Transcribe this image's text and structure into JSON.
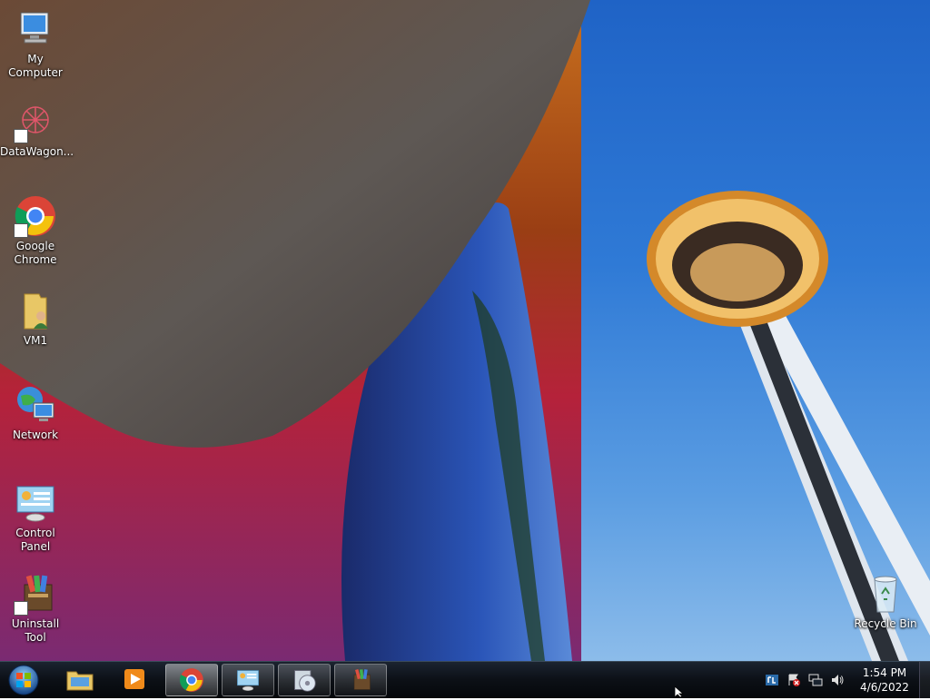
{
  "desktop": {
    "icons": [
      {
        "label": "My Computer",
        "icon": "computer-icon"
      },
      {
        "label": "DataWagon...",
        "icon": "datawagon-icon"
      },
      {
        "label": "Google Chrome",
        "icon": "chrome-icon"
      },
      {
        "label": "VM1",
        "icon": "user-folder-icon"
      },
      {
        "label": "Network",
        "icon": "network-icon"
      },
      {
        "label": "Control Panel",
        "icon": "control-panel-icon"
      },
      {
        "label": "Uninstall Tool",
        "icon": "uninstall-tool-icon"
      },
      {
        "label": "Recycle Bin",
        "icon": "recycle-bin-icon"
      }
    ]
  },
  "taskbar": {
    "start_icon": "windows-start-orb-icon",
    "pinned": [
      {
        "icon": "file-explorer-icon"
      },
      {
        "icon": "media-player-icon"
      },
      {
        "icon": "chrome-icon"
      },
      {
        "icon": "control-panel-icon"
      },
      {
        "icon": "disk-utility-icon"
      },
      {
        "icon": "uninstall-tool-icon"
      }
    ],
    "tray_icons": [
      "keyboard-language-icon",
      "action-center-icon",
      "network-icon",
      "volume-icon"
    ],
    "clock": {
      "time": "1:54 PM",
      "date": "4/6/2022"
    }
  }
}
